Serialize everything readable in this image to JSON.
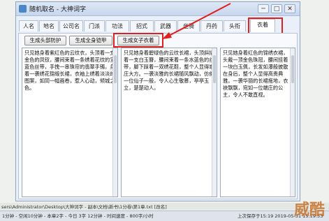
{
  "window": {
    "title": "随机取名 - 大神词字",
    "minimize": "─",
    "maximize": "□",
    "close": "✕"
  },
  "tabs": [
    "人名",
    "地名",
    "公司名",
    "门派",
    "功法",
    "招式",
    "武器",
    "坐骑",
    "丹药",
    "头衔",
    "衣着"
  ],
  "active_tab": "衣着",
  "buttons": {
    "head_armor": "生成头部防护",
    "full_armor": "生成全身铠甲",
    "female_clothes": "生成女子衣着"
  },
  "text_columns": [
    "只见她身着紫红色的云纹衣，头顶着一支金色的凤钗，腰间束着一条绣着花纹的宝蓝色丝带，手挽一串珠帘的翡翠手镯，身着一袭绣花锦缎长裙，衣袖上绣着淡淡的图案，如同一幅画卷，惹人心动，倾城之色。",
    "只见她身着碧绿色的云纹长裙，头顶斜插着一支白玉簪，腰间束着一条水蓝色的丝带，脚下踩着一双绣花鞋，整个人显得端庄大方。一袭淡雅的长裙随风飘动，仿佛一位仙子一般，令人心生敬慕，亭亭玉立，楚楚动人。",
    "只见她身着红色的锦绣衣裙，头戴一顶金色珠冠，腰间挂着一块白玉佩，长发如瀑般披散在身后，整个人显得高贵典雅。一袭华丽的长裙拖地，衣袂飘飘，宛如一位端庄的公主，令人不敢直视。"
  ],
  "editor": {
    "path": "sers\\Administrator\\Desktop\\大神词字 - 副本\\文档\\新书\\1分卷\\第1章.txt  [改名]",
    "status": "1分钟 - 空闲10分钟 - 本章2字 - 今日 3字 12分钟 - 时间速度 - 800字/小时",
    "time": "上次保存于15:19  2019-05-31 15:19:53"
  },
  "watermark": "威酷"
}
